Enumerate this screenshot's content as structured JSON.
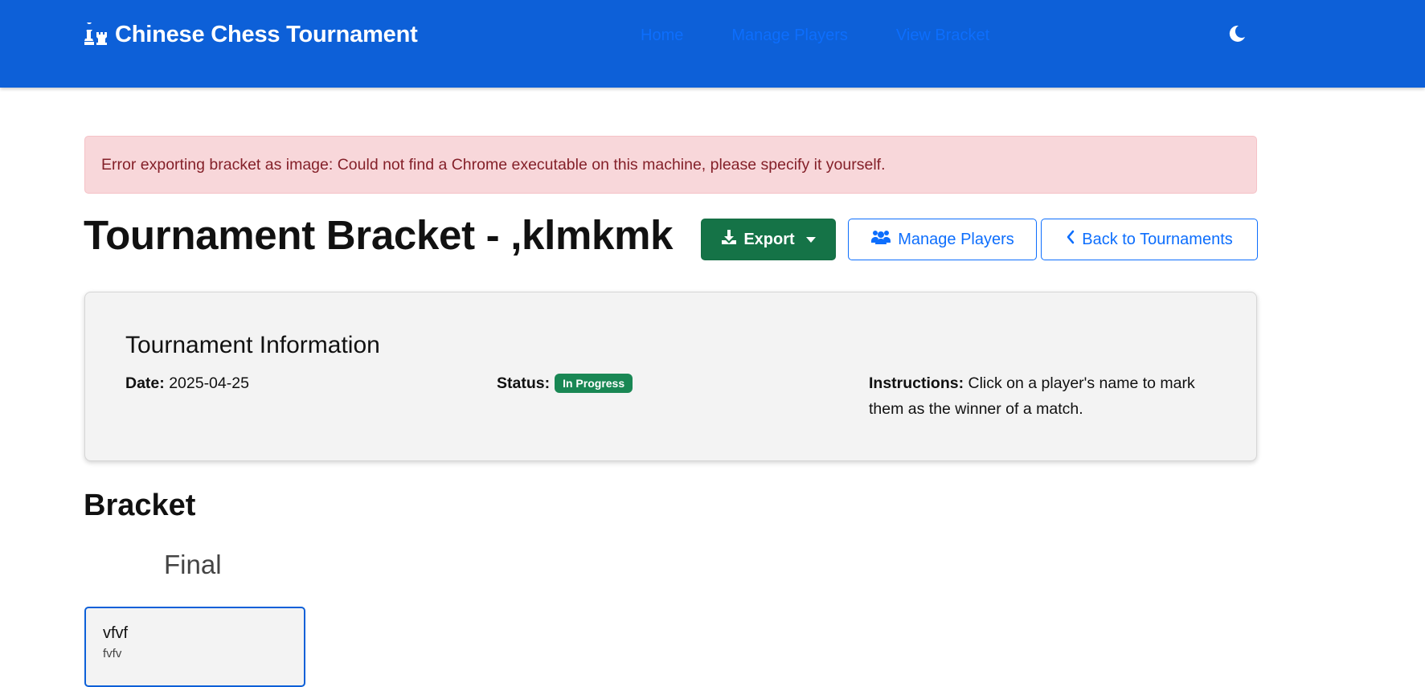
{
  "navbar": {
    "brand_title": "Chinese Chess Tournament",
    "brand_icon": "chess-pieces-icon",
    "links": [
      {
        "label": "Home"
      },
      {
        "label": "Manage Players"
      },
      {
        "label": "View Bracket"
      }
    ],
    "theme_toggle_icon": "moon-icon"
  },
  "alert": {
    "message": "Error exporting bracket as image: Could not find a Chrome executable on this machine, please specify it yourself."
  },
  "page": {
    "title": "Tournament Bracket - ,klmkmk"
  },
  "actions": {
    "export_label": "Export",
    "manage_players_label": "Manage Players",
    "back_label": "Back to Tournaments"
  },
  "info_card": {
    "title": "Tournament Information",
    "date_label": "Date:",
    "date_value": "2025-04-25",
    "status_label": "Status:",
    "status_value": "In Progress",
    "instructions_label": "Instructions:",
    "instructions_text": "Click on a player's name to mark them as the winner of a match."
  },
  "bracket": {
    "section_title": "Bracket",
    "rounds": [
      {
        "name": "Final",
        "matches": [
          {
            "player1": "vfvf",
            "player2": "fvfv"
          }
        ]
      }
    ]
  },
  "colors": {
    "navbar_bg": "#0d60d8",
    "link": "#0d6efd",
    "success": "#157347",
    "alert_bg": "#f8d7da",
    "alert_text": "#842029"
  }
}
